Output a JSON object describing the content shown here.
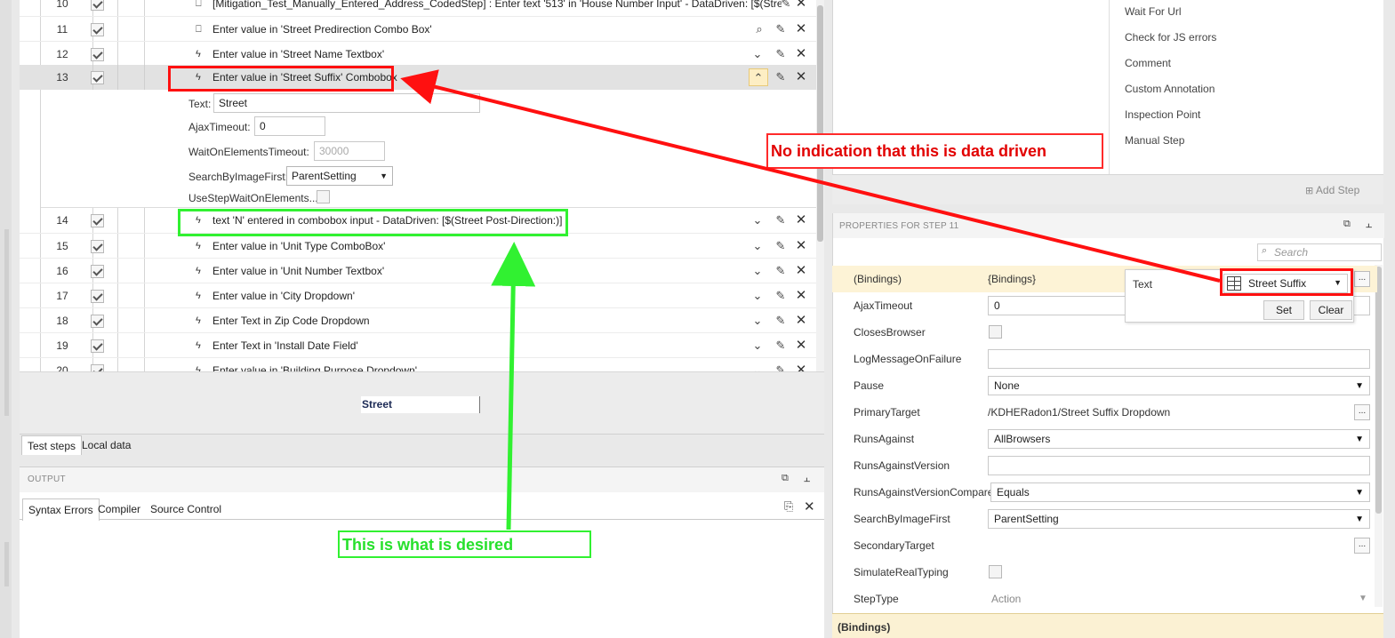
{
  "steps": [
    {
      "num": "10",
      "icon": "code-step-icon",
      "desc": "[Mitigation_Test_Manually_Entered_Address_CodedStep] : Enter text '513' in 'House Number Input' - DataDriven: [$(Stre",
      "action": "search"
    },
    {
      "num": "11",
      "icon": "code-step-icon",
      "desc": "Enter value in 'Street Predirection Combo Box'",
      "action": "search"
    },
    {
      "num": "12",
      "icon": "lightning-icon",
      "desc": "Enter value in 'Street Name Textbox'",
      "action": "expand"
    },
    {
      "num": "13",
      "icon": "lightning-icon",
      "desc": "Enter value in 'Street Suffix' Combobox",
      "action": "collapse"
    },
    {
      "num": "14",
      "icon": "lightning-icon",
      "desc": "text 'N' entered in combobox input - DataDriven: [$(Street Post-Direction:)]",
      "action": "expand"
    },
    {
      "num": "15",
      "icon": "lightning-icon",
      "desc": "Enter value in 'Unit Type ComboBox'",
      "action": "expand"
    },
    {
      "num": "16",
      "icon": "lightning-icon",
      "desc": "Enter value in 'Unit Number Textbox'",
      "action": "expand"
    },
    {
      "num": "17",
      "icon": "lightning-icon",
      "desc": "Enter value in 'City Dropdown'",
      "action": "expand"
    },
    {
      "num": "18",
      "icon": "lightning-icon",
      "desc": "Enter Text in Zip Code Dropdown",
      "action": "expand"
    },
    {
      "num": "19",
      "icon": "lightning-icon",
      "desc": "Enter Text in 'Install Date Field'",
      "action": "expand"
    },
    {
      "num": "20",
      "icon": "lightning-icon",
      "desc": "Enter value in 'Building Purpose Dropdown'",
      "action": "expand"
    }
  ],
  "step13_props": {
    "text_label": "Text:",
    "text_value": "Street",
    "ajax_label": "AjaxTimeout:",
    "ajax_value": "0",
    "wait_label": "WaitOnElementsTimeout:",
    "wait_placeholder": "30000",
    "search_label": "SearchByImageFirst:",
    "search_value": "ParentSetting",
    "usestep_label": "UseStepWaitOnElements..."
  },
  "preview_text": "Street",
  "bottom_tabs": [
    "Test steps",
    "Local data"
  ],
  "output": {
    "title": "OUTPUT",
    "tabs": [
      "Syntax Errors",
      "Compiler",
      "Source Control"
    ]
  },
  "toolbox_items": [
    "Wait For Url",
    "Check for JS errors",
    "Comment",
    "Custom Annotation",
    "Inspection Point",
    "Manual Step"
  ],
  "add_step_label": "Add Step",
  "properties": {
    "title": "PROPERTIES FOR STEP 11",
    "search_placeholder": "Search",
    "rows": [
      {
        "name": "(Bindings)",
        "value": "{Bindings}",
        "kind": "bindings"
      },
      {
        "name": "AjaxTimeout",
        "value": "0",
        "kind": "text"
      },
      {
        "name": "ClosesBrowser",
        "value": "",
        "kind": "check"
      },
      {
        "name": "LogMessageOnFailure",
        "value": "",
        "kind": "text"
      },
      {
        "name": "Pause",
        "value": "None",
        "kind": "select"
      },
      {
        "name": "PrimaryTarget",
        "value": "/KDHERadon1/Street Suffix Dropdown",
        "kind": "dots"
      },
      {
        "name": "RunsAgainst",
        "value": "AllBrowsers",
        "kind": "select"
      },
      {
        "name": "RunsAgainstVersion",
        "value": "",
        "kind": "text"
      },
      {
        "name": "RunsAgainstVersionCompare",
        "value": "Equals",
        "kind": "select"
      },
      {
        "name": "SearchByImageFirst",
        "value": "ParentSetting",
        "kind": "select"
      },
      {
        "name": "SecondaryTarget",
        "value": "",
        "kind": "dotsonly"
      },
      {
        "name": "SimulateRealTyping",
        "value": "",
        "kind": "check"
      },
      {
        "name": "StepType",
        "value": "Action",
        "kind": "grey-select"
      }
    ],
    "desc_title": "(Bindings)"
  },
  "binding_popup": {
    "label": "Text",
    "value": "Street Suffix",
    "set_label": "Set",
    "clear_label": "Clear"
  },
  "annotations": {
    "red_text": "No indication that this is data driven",
    "green_text": "This is what is desired"
  },
  "colors": {
    "red": "#ff1010",
    "green": "#31f131",
    "selected_row": "#e2e2e2",
    "bindings_row": "#fdf3d6"
  }
}
